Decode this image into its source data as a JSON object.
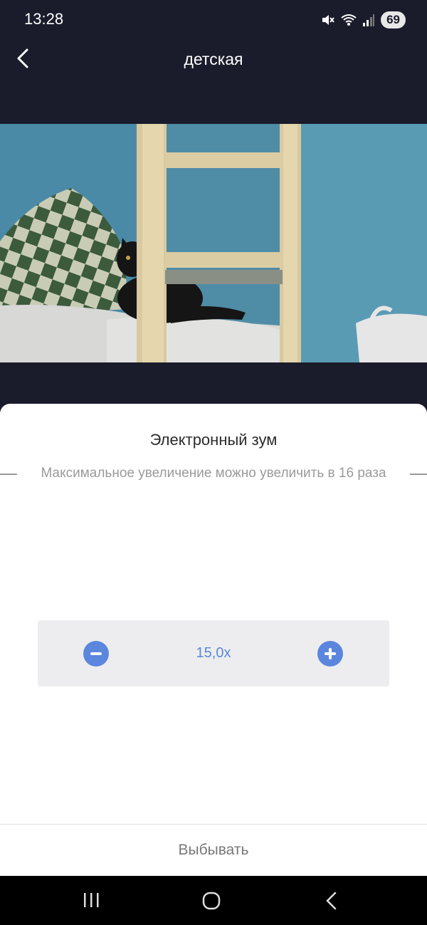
{
  "status_bar": {
    "time": "13:28",
    "battery": "69",
    "icons": [
      "mute-icon",
      "wifi-icon",
      "signal-icon"
    ]
  },
  "header": {
    "title": "детская",
    "back_icon": "chevron-left-icon"
  },
  "camera": {
    "description_icon": "camera-feed"
  },
  "zoom_sheet": {
    "title": "Электронный зум",
    "hint": "Максимальное увеличение можно увеличить в 16 раза",
    "zoom_value": "15,0x",
    "decrease_icon": "minus-icon",
    "increase_icon": "plus-icon",
    "dismiss_label": "Выбывать"
  },
  "nav_bar": {
    "icons": [
      "recent-apps-icon",
      "home-icon",
      "back-icon"
    ]
  },
  "colors": {
    "accent": "#5b86de",
    "app_background": "#1a1c2b"
  }
}
